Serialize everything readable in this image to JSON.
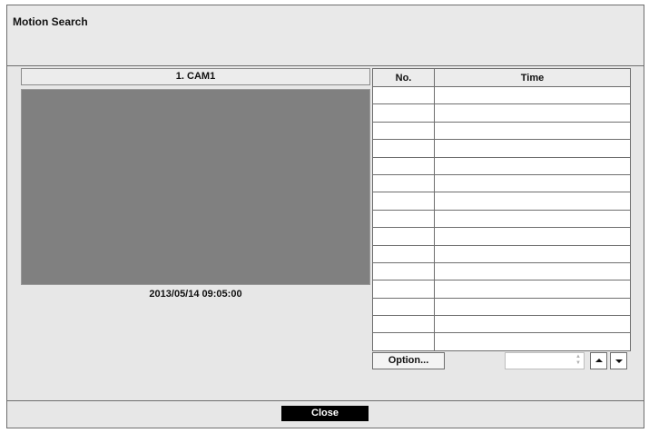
{
  "dialog": {
    "title": "Motion Search"
  },
  "camera": {
    "name": "1. CAM1",
    "timestamp": "2013/05/14  09:05:00"
  },
  "event_table": {
    "columns": [
      "No.",
      "Time"
    ],
    "rows": [
      [
        "",
        ""
      ],
      [
        "",
        ""
      ],
      [
        "",
        ""
      ],
      [
        "",
        ""
      ],
      [
        "",
        ""
      ],
      [
        "",
        ""
      ],
      [
        "",
        ""
      ],
      [
        "",
        ""
      ],
      [
        "",
        ""
      ],
      [
        "",
        ""
      ],
      [
        "",
        ""
      ],
      [
        "",
        ""
      ],
      [
        "",
        ""
      ],
      [
        "",
        ""
      ],
      [
        "",
        ""
      ]
    ]
  },
  "controls": {
    "option_label": "Option...",
    "page_value": "",
    "up_icon": "arrow-up-icon",
    "down_icon": "arrow-down-icon",
    "close_label": "Close"
  },
  "colors": {
    "video_bg": "#808080",
    "dialog_bg": "#e7e7e7",
    "close_bg": "#000000"
  }
}
